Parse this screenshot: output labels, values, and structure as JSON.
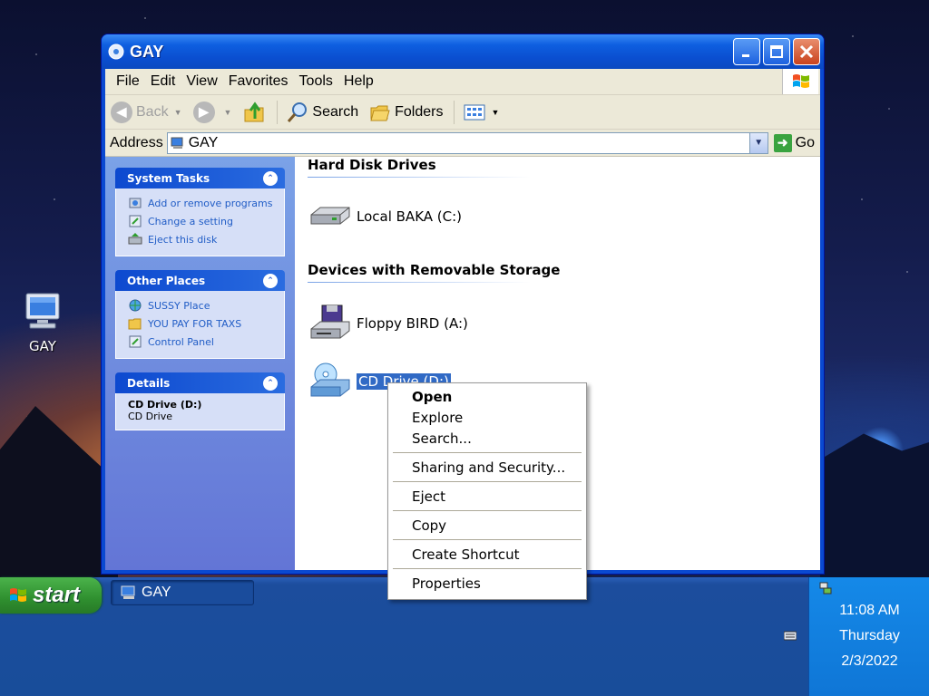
{
  "desktop": {
    "icons": [
      {
        "label": "GAY",
        "icon": "my-computer-icon"
      }
    ]
  },
  "window": {
    "title": "GAY",
    "menu": [
      "File",
      "Edit",
      "View",
      "Favorites",
      "Tools",
      "Help"
    ],
    "toolbar": {
      "back": "Back",
      "search": "Search",
      "folders": "Folders"
    },
    "address": {
      "label": "Address",
      "value": "GAY",
      "go": "Go"
    },
    "taskpane": {
      "system_tasks": {
        "title": "System Tasks",
        "items": [
          "Add or remove programs",
          "Change a setting",
          "Eject this disk"
        ]
      },
      "other_places": {
        "title": "Other Places",
        "items": [
          "SUSSY Place",
          "YOU PAY FOR TAXS",
          "Control Panel"
        ]
      },
      "details": {
        "title": "Details",
        "name": "CD Drive (D:)",
        "type": "CD Drive"
      }
    },
    "groups": {
      "hard_disks": {
        "title": "Hard Disk Drives",
        "items": [
          "Local BAKA (C:)"
        ]
      },
      "removable": {
        "title": "Devices with Removable Storage",
        "items": [
          "Floppy BIRD (A:)",
          "CD Drive (D:)"
        ]
      }
    }
  },
  "context_menu": {
    "items": [
      "Open",
      "Explore",
      "Search...",
      "Sharing and Security...",
      "Eject",
      "Copy",
      "Create Shortcut",
      "Properties"
    ]
  },
  "taskbar": {
    "start": "start",
    "task_item": "GAY",
    "clock": {
      "time": "11:08 AM",
      "day": "Thursday",
      "date": "2/3/2022"
    }
  },
  "colors": {
    "titlebar": "#0a49d1",
    "selection": "#316ac5",
    "start_green": "#2f8f2f",
    "taskpane_link": "#215dc6"
  }
}
